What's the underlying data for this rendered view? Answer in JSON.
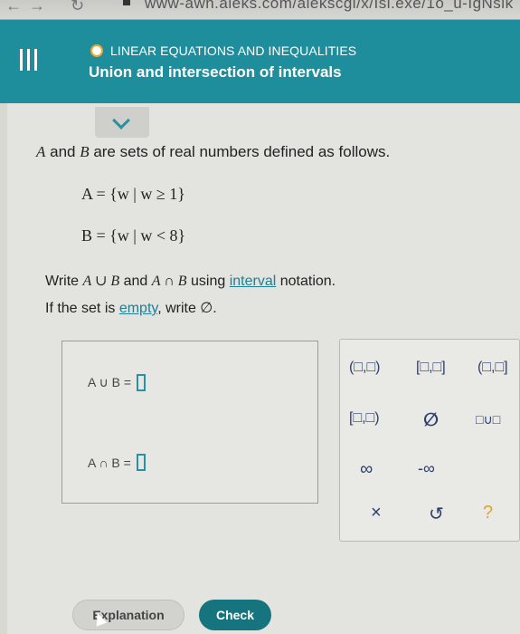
{
  "browser": {
    "url_visible": "www-awn.aleks.com/alekscgi/x/Isl.exe/1o_u-IgNslk"
  },
  "header": {
    "topic": "LINEAR EQUATIONS AND INEQUALITIES",
    "title": "Union and intersection of intervals",
    "accent": "#1f8e9c"
  },
  "problem": {
    "intro_pre": "",
    "intro_a": "A",
    "intro_mid": " and ",
    "intro_b": "B",
    "intro_post": " are sets of real numbers defined as follows.",
    "set_a": "A = {w | w ≥ 1}",
    "set_b": "B = {w | w < 8}",
    "instr1_pre": "Write ",
    "instr1_expr": "A ∪ B",
    "instr1_mid": " and ",
    "instr1_expr2": "A ∩ B",
    "instr1_mid2": " using ",
    "instr1_link": "interval",
    "instr1_post": " notation.",
    "instr2_pre": "If the set is ",
    "instr2_link": "empty",
    "instr2_post": ", write ∅."
  },
  "answers": {
    "union_label": "A ∪ B =",
    "intersection_label": "A ∩ B ="
  },
  "palette": {
    "open_open": "(□,□)",
    "closed_closed": "[□,□]",
    "open_closed": "(□,□]",
    "closed_open": "[□,□)",
    "empty": "∅",
    "union": "□∪□",
    "infinity": "∞",
    "neg_infinity": "-∞",
    "clear": "×",
    "undo": "↺",
    "help": "?"
  },
  "buttons": {
    "explanation": "Explanation",
    "check": "Check"
  }
}
